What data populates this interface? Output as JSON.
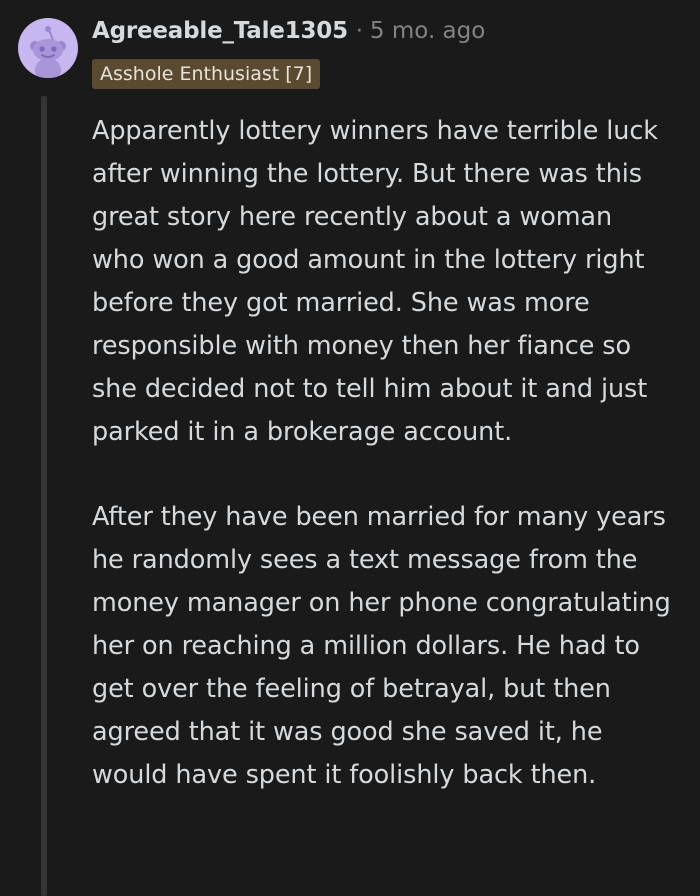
{
  "comment": {
    "username": "Agreeable_Tale1305",
    "separator": "·",
    "timestamp": "5 mo. ago",
    "flair": "Asshole Enthusiast [7]",
    "avatar_icon": "snoo-avatar-icon",
    "paragraphs": [
      "Apparently lottery winners have terrible luck after winning the lottery. But there was this great story here recently about a woman who won a good amount in the lottery right before they got married. She was more responsible with money then her fiance so she decided not to tell him about it and just parked it in a brokerage account.",
      "After they have been married for many years he randomly sees a text message from the money manager on her phone congratulating her on reaching a million dollars. He had to get over the feeling of betrayal, but then agreed that it was good she saved it, he would have spent it foolishly back then."
    ]
  },
  "colors": {
    "background": "#1a1a1b",
    "text": "#d7dadc",
    "muted": "#818384",
    "flair_bg": "#5a4a31",
    "avatar_bg": "#c7b7f0",
    "thread_line": "#343536"
  }
}
